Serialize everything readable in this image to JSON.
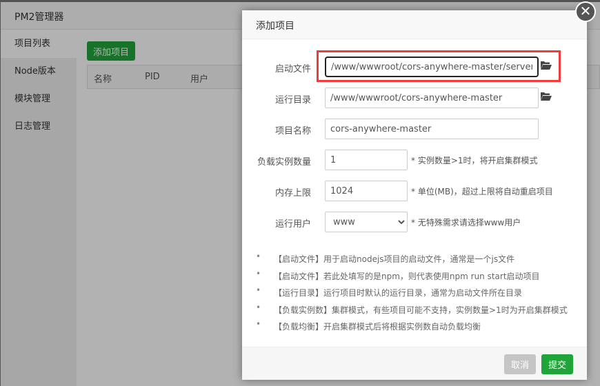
{
  "app": {
    "title": "PM2管理器"
  },
  "sidebar": {
    "items": [
      {
        "label": "项目列表",
        "active": true
      },
      {
        "label": "Node版本"
      },
      {
        "label": "模块管理"
      },
      {
        "label": "日志管理"
      }
    ]
  },
  "main": {
    "add_button": "添加项目",
    "columns": [
      "名称",
      "PID",
      "用户"
    ]
  },
  "modal": {
    "title": "添加项目",
    "fields": {
      "start_file": {
        "label": "启动文件",
        "value": "/www/wwwroot/cors-anywhere-master/server.js"
      },
      "run_dir": {
        "label": "运行目录",
        "value": "/www/wwwroot/cors-anywhere-master"
      },
      "name": {
        "label": "项目名称",
        "value": "cors-anywhere-master"
      },
      "instances": {
        "label": "负载实例数量",
        "value": "1",
        "hint": "* 实例数量>1时，将开启集群模式"
      },
      "memory": {
        "label": "内存上限",
        "value": "1024",
        "hint": "* 单位(MB)，超过上限将自动重启项目"
      },
      "user": {
        "label": "运行用户",
        "value": "www",
        "hint": "* 无特殊需求请选择www用户"
      }
    },
    "notes": [
      "【启动文件】用于启动nodejs项目的启动文件，通常是一个js文件",
      "【启动文件】若此处填写的是npm，则代表使用npm run start启动项目",
      "【运行目录】运行项目时默认的运行目录，通常为启动文件所在目录",
      "【负载实例数】集群模式，有些项目可能不支持，实例数量>1时为开启集群模式",
      "【负载均衡】开启集群模式后将根据实例数自动负载均衡"
    ],
    "cancel": "取消",
    "submit": "提交"
  },
  "colors": {
    "accent": "#20a53a",
    "highlight": "#f23a3a"
  }
}
